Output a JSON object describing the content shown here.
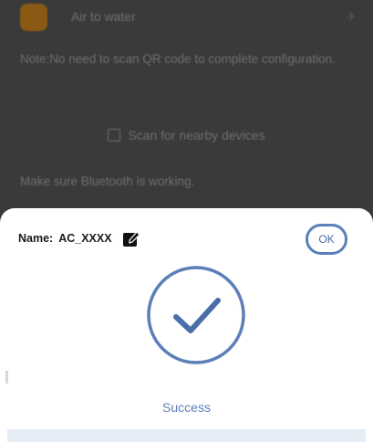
{
  "background": {
    "title": "Air to water",
    "header_right": "✈",
    "note": "Note:No need to scan QR code to complete configuration.",
    "scan_label": "Scan for nearby devices",
    "bluetooth_note": "Make sure Bluetooth is working."
  },
  "sheet": {
    "name_label": "Name:",
    "name_value": "AC_XXXX",
    "ok_label": "OK",
    "status_text": "Success"
  },
  "colors": {
    "accent": "#5b7fb8",
    "overlay": "#3a3a3a"
  }
}
